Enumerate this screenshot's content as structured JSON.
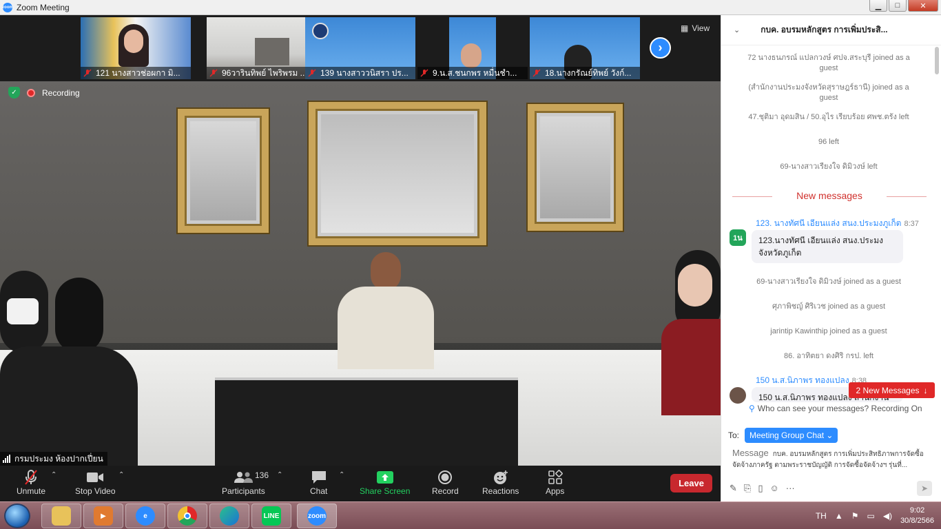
{
  "window": {
    "title": "Zoom Meeting",
    "minimize": "▁",
    "maximize": "□",
    "close": "✕"
  },
  "thumbnails": [
    {
      "name": "121 นางสาวช่อผกา  มิ..."
    },
    {
      "name": "96วารินทิพย์ ไพริพรม ..."
    },
    {
      "name": "139 นางสาววนิสรา ปร..."
    },
    {
      "name": "9.น.ส.ชนกพร หมื่นชำ..."
    },
    {
      "name": "18.นางกรัณย์ทิพย์ วังก์..."
    }
  ],
  "view_label": "View",
  "recording_label": "Recording",
  "speaker_name": "กรมประมง ห้องปากเปี่ยน",
  "toolbar": {
    "unmute": "Unmute",
    "stop_video": "Stop Video",
    "participants": "Participants",
    "participants_count": "136",
    "chat": "Chat",
    "share_screen": "Share Screen",
    "record": "Record",
    "reactions": "Reactions",
    "apps": "Apps",
    "leave": "Leave"
  },
  "chat": {
    "title": "กบค. อบรมหลักสูตร การเพิ่มประสิ...",
    "system_messages": [
      "72 นางธนภรณ์ แปลกวงษ์  ศปจ.สระบุรี joined as a guest",
      "(สำนักงานประมงจังหวัดสุราษฎร์ธานี) joined as a guest",
      "47.ชุติมา อุดมสิน / 50.อุไร เรียบร้อย ศพช.ตรัง left",
      "96 left",
      "69-นางสาวเรียงใจ  ดิมิวงษ์ left"
    ],
    "new_messages_divider": "New messages",
    "message1": {
      "avatar": "1น",
      "sender": "123. นางทัศนี เอียนแล่ง สนง.ประมงภูเก็ต",
      "time": "8:37",
      "text": "123.นางทัศนี เอียนแล่ง สนง.ประมงจังหวัดภูเก็ต"
    },
    "system_messages2": [
      "69-นางสาวเรียงใจ  ดิมิวงษ์ joined as a guest",
      "ศุภาพิชญ์ ศิริเวช joined as a guest",
      "jarintip Kawinthip joined as a guest",
      "86. อาทิตยา ดงศิริ กรป. left"
    ],
    "message2": {
      "sender": "150 น.ส.นิภาพร ทองแปลง",
      "time": "8:38",
      "text": "150 น.ส.นิภาพร ทองแปลง สำนักงานประมง"
    },
    "new_messages_badge": "2 New Messages",
    "who_can_see": "Who can see your messages? Recording On",
    "to_label": "To:",
    "to_value": "Meeting Group Chat",
    "message_placeholder": "Message",
    "message_draft": "กบค. อบรมหลักสูตร การเพิ่มประสิทธิภาพการจัดซื้อจัดจ้างภาครัฐ ตามพระราชบัญญัติ การจัดซื้อจัดจ้างฯ รุ่นที่..."
  },
  "taskbar": {
    "lang": "TH",
    "time": "9:02",
    "date": "30/8/2566"
  },
  "colors": {
    "accent": "#2d8cff",
    "leave": "#c8282e",
    "share_green": "#23d160"
  }
}
